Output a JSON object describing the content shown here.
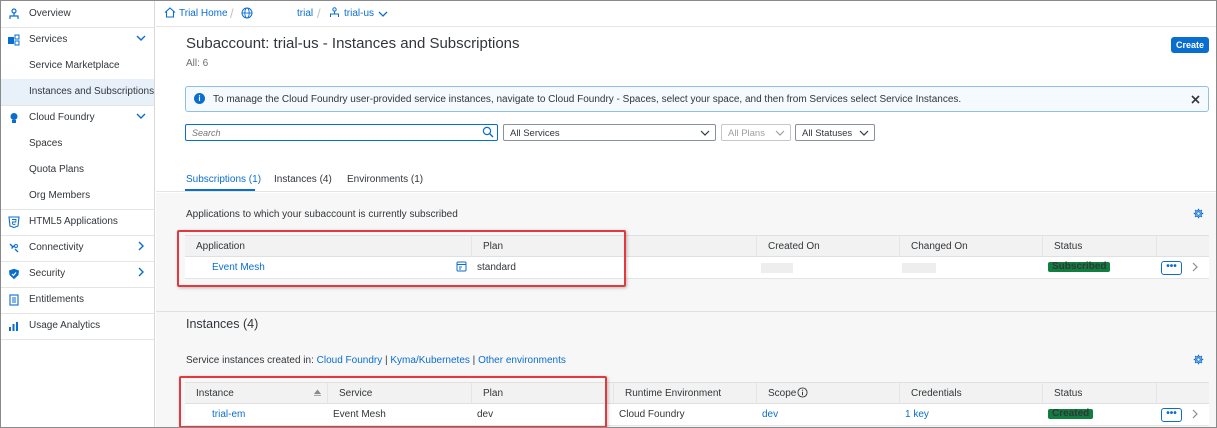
{
  "sidebar": {
    "items": [
      {
        "label": "Overview",
        "icon": "overview-icon"
      },
      {
        "label": "Services",
        "icon": "services-icon",
        "chevron": "down"
      },
      {
        "label": "Service Marketplace"
      },
      {
        "label": "Instances and Subscriptions"
      },
      {
        "label": "Cloud Foundry",
        "icon": "cloud-foundry-icon",
        "chevron": "down"
      },
      {
        "label": "Spaces"
      },
      {
        "label": "Quota Plans"
      },
      {
        "label": "Org Members"
      },
      {
        "label": "HTML5 Applications",
        "icon": "html5-icon"
      },
      {
        "label": "Connectivity",
        "icon": "connectivity-icon",
        "chevron": "right"
      },
      {
        "label": "Security",
        "icon": "shield-icon",
        "chevron": "right"
      },
      {
        "label": "Entitlements",
        "icon": "entitlements-icon"
      },
      {
        "label": "Usage Analytics",
        "icon": "analytics-icon"
      }
    ]
  },
  "breadcrumb": {
    "home": "Trial Home",
    "global": "trial",
    "subaccount": "trial-us"
  },
  "header": {
    "title": "Subaccount: trial-us - Instances and Subscriptions",
    "count": "All: 6",
    "create_label": "Create"
  },
  "info": {
    "message": "To manage the Cloud Foundry user-provided service instances, navigate to Cloud Foundry - Spaces, select your space, and then from Services select Service Instances."
  },
  "filters": {
    "search_placeholder": "Search",
    "services": "All Services",
    "plans": "All Plans",
    "statuses": "All Statuses"
  },
  "tabs": [
    {
      "label": "Subscriptions (1)",
      "active": true
    },
    {
      "label": "Instances (4)"
    },
    {
      "label": "Environments (1)"
    }
  ],
  "subscriptions": {
    "description": "Applications to which your subaccount is currently subscribed",
    "columns": [
      "Application",
      "Plan",
      "Created On",
      "Changed On",
      "Status"
    ],
    "rows": [
      {
        "application": "Event Mesh",
        "plan": "standard",
        "status": "Subscribed"
      }
    ]
  },
  "instances": {
    "heading": "Instances (4)",
    "created_in_prefix": "Service instances created in:",
    "link_cf": "Cloud Foundry",
    "link_kyma": "Kyma/Kubernetes",
    "link_other": "Other environments",
    "separator": "|",
    "columns": [
      "Instance",
      "Service",
      "Plan",
      "Runtime Environment",
      "Scope",
      "Credentials",
      "Status"
    ],
    "rows": [
      {
        "instance": "trial-em",
        "service": "Event Mesh",
        "plan": "dev",
        "runtime": "Cloud Foundry",
        "scope": "dev",
        "credentials": "1 key",
        "status": "Created"
      }
    ]
  },
  "colors": {
    "accent": "#0a6ed1",
    "success": "#107e3e",
    "highlight": "#e0393e"
  }
}
